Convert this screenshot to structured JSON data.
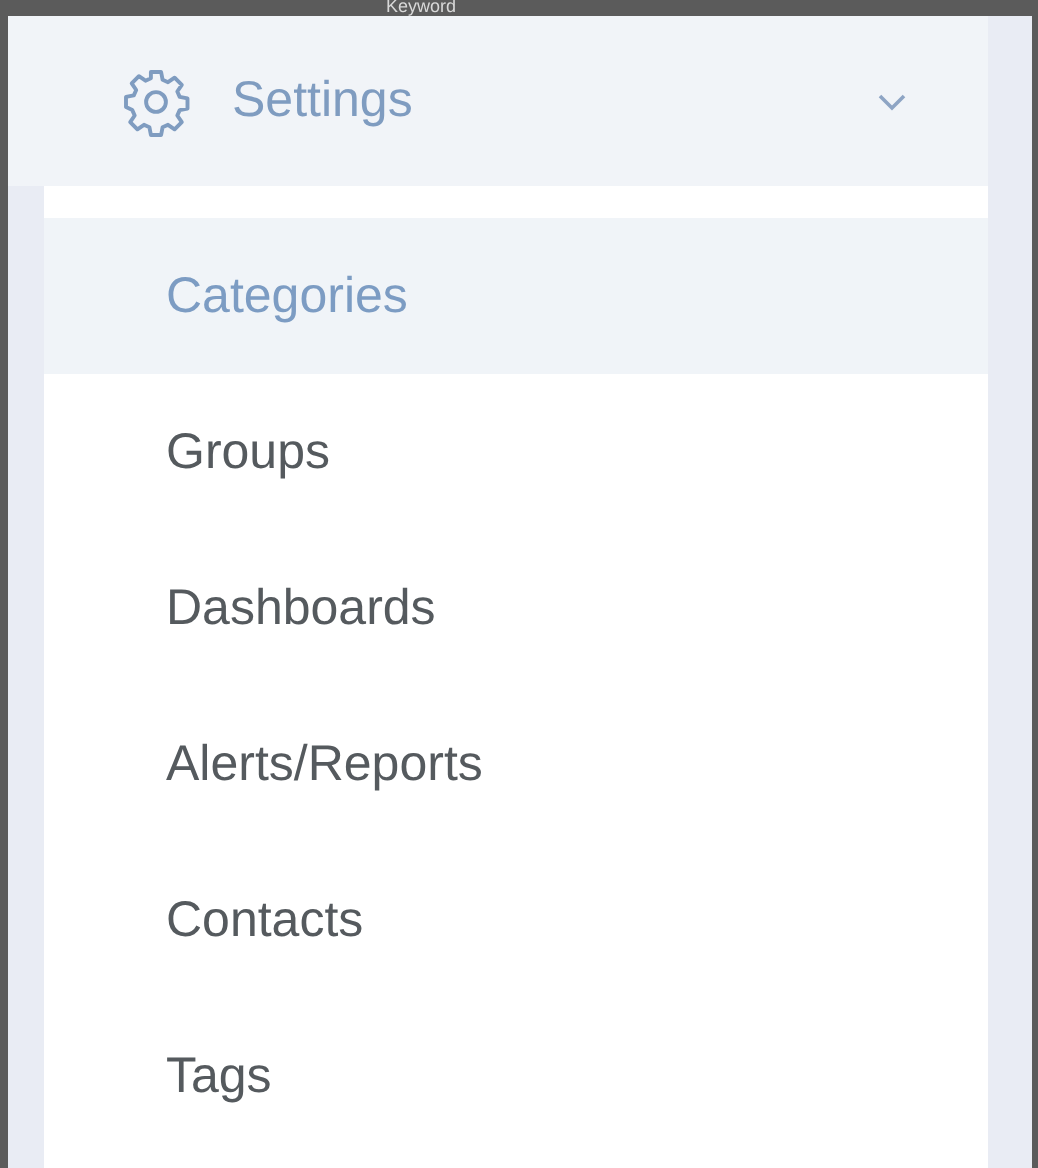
{
  "background": {
    "field_label": "Keyword"
  },
  "menu": {
    "title": "Settings",
    "expanded": true,
    "items": [
      {
        "label": "Categories",
        "selected": true
      },
      {
        "label": "Groups",
        "selected": false
      },
      {
        "label": "Dashboards",
        "selected": false
      },
      {
        "label": "Alerts/Reports",
        "selected": false
      },
      {
        "label": "Contacts",
        "selected": false
      },
      {
        "label": "Tags",
        "selected": false
      }
    ]
  }
}
